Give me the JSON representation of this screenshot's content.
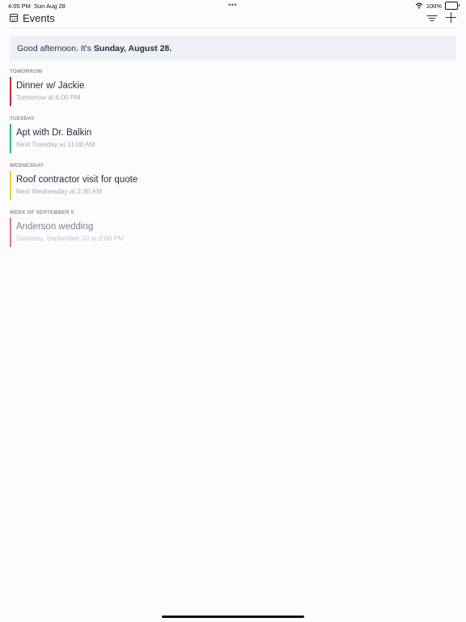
{
  "status_bar": {
    "time": "4:05 PM",
    "date": "Sun Aug 28",
    "battery": "100%",
    "multitask_dots": "•••",
    "icons": [
      "wifi-icon",
      "battery-icon"
    ]
  },
  "header": {
    "title": "Events",
    "icons": [
      "calendar-icon",
      "filter-icon",
      "add-icon"
    ]
  },
  "greeting": {
    "prefix": "Good afternoon. It's",
    "date": "Sunday, August 28."
  },
  "sections": [
    {
      "label": "TOMORROW",
      "events": [
        {
          "title": "Dinner w/ Jackie",
          "time": "Tomorrow at 6:00 PM",
          "color": "#c62d3a"
        }
      ]
    },
    {
      "label": "TUESDAY",
      "events": [
        {
          "title": "Apt with Dr. Balkin",
          "time": "Next Tuesday at 11:00 AM",
          "color": "#34b37a"
        }
      ]
    },
    {
      "label": "WEDNESDAY",
      "events": [
        {
          "title": "Roof contractor visit for quote",
          "time": "Next Wednesday at 2:30 AM",
          "color": "#ecd03b"
        }
      ]
    },
    {
      "label": "WEEK OF SEPTEMBER 5",
      "events": [
        {
          "title": "Anderson wedding",
          "time": "Saturday, September 10 at 2:00 PM",
          "color": "#d67a84"
        }
      ]
    }
  ]
}
